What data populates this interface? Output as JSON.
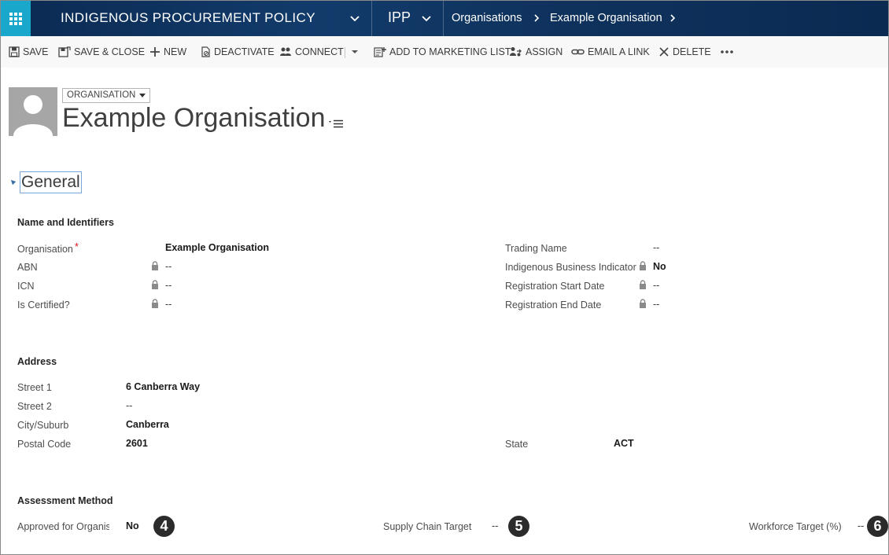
{
  "nav": {
    "app_title": "INDIGENOUS PROCUREMENT POLICY",
    "module": "IPP",
    "breadcrumbs": [
      "Organisations",
      "Example Organisation"
    ]
  },
  "commands": {
    "save": "SAVE",
    "save_close": "SAVE & CLOSE",
    "new": "NEW",
    "deactivate": "DEACTIVATE",
    "connect": "CONNECT",
    "add_marketing": "ADD TO MARKETING LIST",
    "assign": "ASSIGN",
    "email_link": "EMAIL A LINK",
    "delete": "DELETE"
  },
  "header": {
    "entity_type": "ORGANISATION",
    "record_name": "Example Organisation"
  },
  "section": {
    "title": "General"
  },
  "names": {
    "title": "Name and Identifiers",
    "organisation_label": "Organisation",
    "organisation_value": "Example Organisation",
    "abn_label": "ABN",
    "abn_value": "--",
    "icn_label": "ICN",
    "icn_value": "--",
    "certified_label": "Is Certified?",
    "certified_value": "--",
    "trading_label": "Trading Name",
    "trading_value": "--",
    "indig_label": "Indigenous Business Indicator",
    "indig_value": "No",
    "reg_start_label": "Registration Start Date",
    "reg_start_value": "--",
    "reg_end_label": "Registration End Date",
    "reg_end_value": "--"
  },
  "address": {
    "title": "Address",
    "street1_label": "Street 1",
    "street1_value": "6 Canberra Way",
    "street2_label": "Street 2",
    "street2_value": "--",
    "city_label": "City/Suburb",
    "city_value": "Canberra",
    "postal_label": "Postal Code",
    "postal_value": "2601",
    "state_label": "State",
    "state_value": "ACT"
  },
  "assessment": {
    "title": "Assessment Method",
    "approved_label": "Approved for Organis",
    "approved_value": "No",
    "supply_label": "Supply Chain Target (%",
    "supply_value": "--",
    "workforce_label": "Workforce Target (%)",
    "workforce_value": "--"
  },
  "badges": [
    "4",
    "5",
    "6"
  ],
  "colors": {
    "nav_bg": "#0b2a52",
    "app_tile": "#19a8cc",
    "command_bg": "#f8f8f8",
    "required": "#dd1111"
  }
}
